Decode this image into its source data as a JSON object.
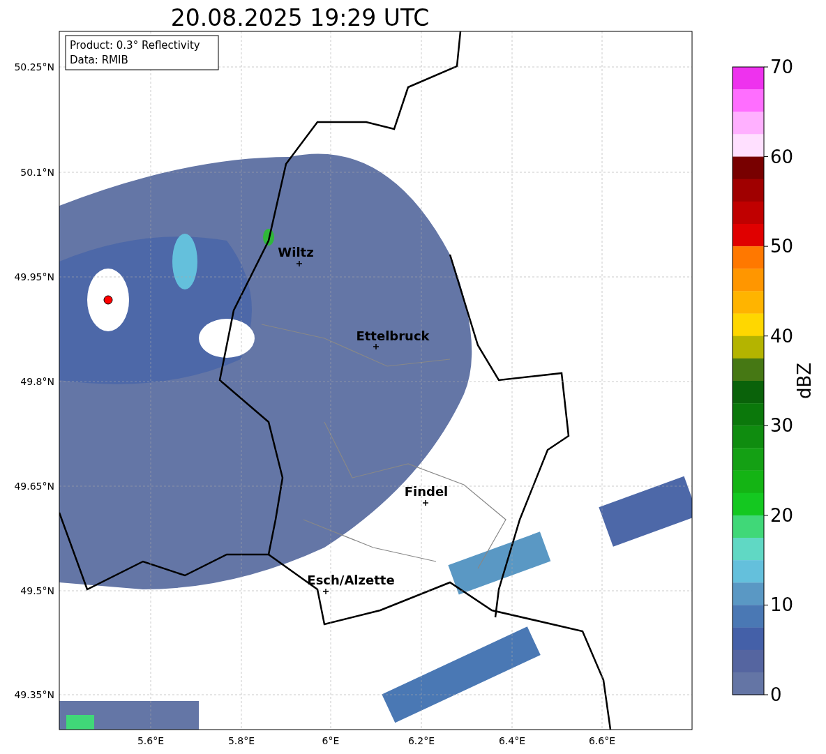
{
  "title": "20.08.2025 19:29 UTC",
  "info_box": {
    "lines": [
      "Product: 0.3° Reflectivity",
      "Data: RMIB"
    ]
  },
  "map": {
    "lat_ticks": [
      "50.25°N",
      "50.1°N",
      "49.95°N",
      "49.8°N",
      "49.65°N",
      "49.5°N",
      "49.35°N"
    ],
    "lon_ticks": [
      "5.6°E",
      "5.8°E",
      "6°E",
      "6.2°E",
      "6.4°E",
      "6.6°E"
    ],
    "cities": [
      {
        "name": "Wiltz"
      },
      {
        "name": "Ettelbruck"
      },
      {
        "name": "Findel"
      },
      {
        "name": "Esch/Alzette"
      }
    ]
  },
  "colorbar": {
    "label": "dBZ",
    "ticks": [
      "70",
      "60",
      "50",
      "40",
      "30",
      "20",
      "10",
      "0"
    ],
    "steps": [
      {
        "color": "#ee32ee"
      },
      {
        "color": "#ff6eff"
      },
      {
        "color": "#ffb0ff"
      },
      {
        "color": "#ffe0ff"
      },
      {
        "color": "#780000"
      },
      {
        "color": "#a00000"
      },
      {
        "color": "#c00000"
      },
      {
        "color": "#e00000"
      },
      {
        "color": "#ff7800"
      },
      {
        "color": "#ff9600"
      },
      {
        "color": "#ffb400"
      },
      {
        "color": "#ffd700"
      },
      {
        "color": "#b4b400"
      },
      {
        "color": "#467814"
      },
      {
        "color": "#0a620a"
      },
      {
        "color": "#0b780b"
      },
      {
        "color": "#0f8c0f"
      },
      {
        "color": "#14a014"
      },
      {
        "color": "#14b414"
      },
      {
        "color": "#14c820"
      },
      {
        "color": "#40d878"
      },
      {
        "color": "#60d8c4"
      },
      {
        "color": "#64c0dc"
      },
      {
        "color": "#5a98c4"
      },
      {
        "color": "#4a78b4"
      },
      {
        "color": "#4460a8"
      },
      {
        "color": "#5565a0"
      },
      {
        "color": "#6475a5"
      }
    ]
  }
}
